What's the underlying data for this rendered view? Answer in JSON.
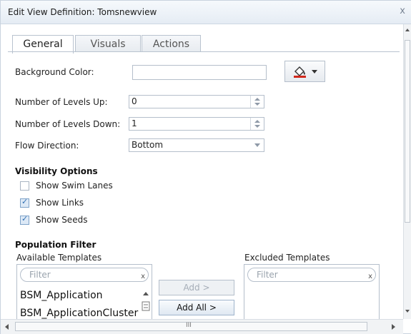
{
  "window": {
    "title": "Edit View Definition: Tomsnewview",
    "close_glyph": "x"
  },
  "tabs": [
    {
      "label": "General",
      "active": true
    },
    {
      "label": "Visuals",
      "active": false
    },
    {
      "label": "Actions",
      "active": false
    }
  ],
  "general": {
    "background_color": {
      "label": "Background Color:",
      "value": "",
      "button_icon": "paint-bucket-icon"
    },
    "levels_up": {
      "label": "Number of Levels Up:",
      "value": "0"
    },
    "levels_down": {
      "label": "Number of Levels Down:",
      "value": "1"
    },
    "flow_direction": {
      "label": "Flow Direction:",
      "value": "Bottom"
    }
  },
  "visibility": {
    "heading": "Visibility Options",
    "options": [
      {
        "label": "Show Swim Lanes",
        "checked": false
      },
      {
        "label": "Show Links",
        "checked": true
      },
      {
        "label": "Show Seeds",
        "checked": true
      }
    ]
  },
  "population": {
    "heading": "Population Filter",
    "available": {
      "label": "Available Templates",
      "filter_placeholder": "Filter",
      "items": [
        "BSM_Application",
        "BSM_ApplicationCluster"
      ]
    },
    "excluded": {
      "label": "Excluded Templates",
      "filter_placeholder": "Filter",
      "items": []
    },
    "add_label": "Add >",
    "add_all_label": "Add All >"
  },
  "scrollbar": {
    "h_grip": "III"
  },
  "colors": {
    "accent": "#2f6fb2",
    "border": "#b5bfcb",
    "title_bg": "#e5ecf4"
  }
}
